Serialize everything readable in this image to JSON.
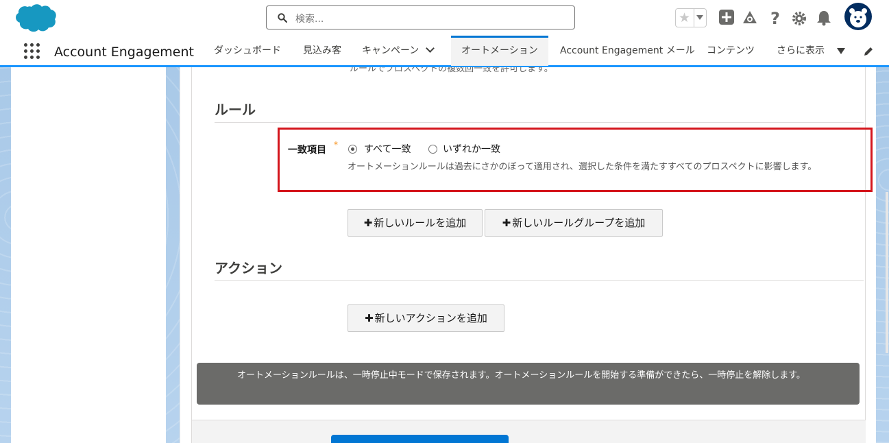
{
  "header": {
    "search_placeholder": "検索...",
    "icons": [
      "salesforce-logo",
      "favorites-star-icon",
      "add-icon",
      "trailhead-icon",
      "help-icon",
      "settings-icon",
      "notifications-bell-icon",
      "user-avatar"
    ]
  },
  "nav": {
    "app_name": "Account Engagement",
    "tabs": [
      {
        "label": "ダッシュボード"
      },
      {
        "label": "見込み客"
      },
      {
        "label": "キャンペーン"
      },
      {
        "label": "オートメーション",
        "active": true
      },
      {
        "label": "Account Engagement メール"
      },
      {
        "label": "コンテンツ"
      },
      {
        "label": "さらに表示"
      }
    ]
  },
  "form": {
    "clipped_text": "ルールでプロスペクトの複数回一致を許可します。",
    "rules_section_title": "ルール",
    "match_label": "一致項目",
    "required_marker": "*",
    "match_options": [
      {
        "label": "すべて一致",
        "selected": true
      },
      {
        "label": "いずれか一致",
        "selected": false
      }
    ],
    "match_help": "オートメーションルールは過去にさかのぼって適用され、選択した条件を満たすすべてのプロスペクトに影響します。",
    "add_rule_button": "新しいルールを追加",
    "add_rule_group_button": "新しいルールグループを追加",
    "actions_section_title": "アクション",
    "add_action_button": "新しいアクションを追加",
    "plus_symbol": "✚",
    "banner_text": "オートメーションルールは、一時停止中モードで保存されます。オートメーションルールを開始する準備ができたら、一時停止を解除します。"
  },
  "colors": {
    "brand_blue": "#0176d3",
    "highlight_red": "#d4151c",
    "banner_gray": "#6b6b69"
  }
}
